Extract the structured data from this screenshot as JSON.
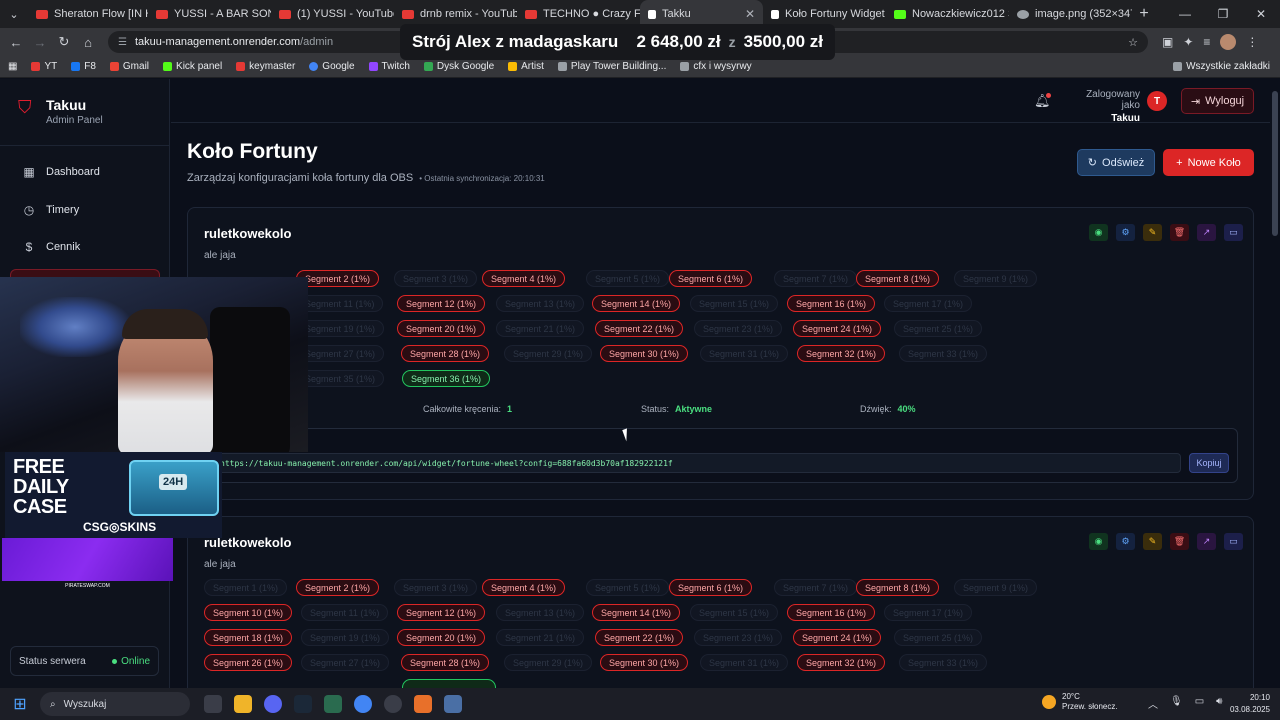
{
  "browser": {
    "tabs": [
      {
        "title": "Sheraton Flow [IN HA",
        "color": "#e53935"
      },
      {
        "title": "YUSSI - A BAR SONG",
        "color": "#e53935"
      },
      {
        "title": "(1) YUSSI - YouTube",
        "color": "#e53935"
      },
      {
        "title": "drnb remix - YouTube",
        "color": "#e53935"
      },
      {
        "title": "TECHNO ● Crazy Fro",
        "color": "#e53935"
      },
      {
        "title": "Takku",
        "color": "#ffffff"
      },
      {
        "title": "Koło Fortuny Widget",
        "color": "#ffffff"
      },
      {
        "title": "Nowaczkiewicz012 St",
        "color": "#53fc18"
      },
      {
        "title": "image.png (352×347)",
        "color": "#9aa0a6"
      }
    ],
    "url_host": "takuu-management.onrender.com",
    "url_path": "/admin",
    "bookmarks": [
      {
        "label": "YT",
        "color": "#e53935"
      },
      {
        "label": "F8",
        "color": "#1877f2"
      },
      {
        "label": "Gmail",
        "color": "#ea4335"
      },
      {
        "label": "Kick panel",
        "color": "#53fc18"
      },
      {
        "label": "keymaster",
        "color": "#e53935"
      },
      {
        "label": "Google",
        "color": "#4285f4"
      },
      {
        "label": "Twitch",
        "color": "#9146ff"
      },
      {
        "label": "Dysk Google",
        "color": "#34a853"
      },
      {
        "label": "Artist",
        "color": "#fbbc04"
      },
      {
        "label": "Play Tower Building...",
        "color": "#9aa0a6"
      },
      {
        "label": "cfx i wysyrwy",
        "color": "#9aa0a6"
      }
    ],
    "bookmarks_all": "Wszystkie zakładki"
  },
  "goal_overlay": {
    "title": "Strój Alex z madagaskaru",
    "current": "2 648,00 zł",
    "separator": "z",
    "target": "3500,00 zł"
  },
  "sidebar": {
    "brand_title": "Takuu",
    "brand_subtitle": "Admin Panel",
    "items": [
      {
        "label": "Dashboard",
        "icon": "grid-icon"
      },
      {
        "label": "Timery",
        "icon": "timer-icon"
      },
      {
        "label": "Cennik",
        "icon": "dollar-icon"
      }
    ],
    "server_status_label": "Status serwera",
    "server_status_value": "Online"
  },
  "topbar": {
    "logged_as_label": "Zalogowany jako",
    "user": "Takuu",
    "avatar_letter": "T",
    "logout_label": "Wyloguj"
  },
  "page": {
    "title": "Koło Fortuny",
    "subtitle": "Zarządzaj konfiguracjami koła fortuny dla OBS",
    "sync": "• Ostatnia synchronizacja: 20:10:31",
    "refresh_label": "Odśwież",
    "new_label": "Nowe Koło"
  },
  "cards": [
    {
      "name": "ruletkowekolo",
      "description": "ale jaja",
      "segments": [
        {
          "label": "Segment 2 (1%)",
          "state": "on"
        },
        {
          "label": "Segment 4 (1%)",
          "state": "on"
        },
        {
          "label": "Segment 6 (1%)",
          "state": "on"
        },
        {
          "label": "Segment 8 (1%)",
          "state": "on"
        },
        {
          "label": "Segment 12 (1%)",
          "state": "on"
        },
        {
          "label": "Segment 14 (1%)",
          "state": "on"
        },
        {
          "label": "Segment 16 (1%)",
          "state": "on"
        },
        {
          "label": "Segment 20 (1%)",
          "state": "on"
        },
        {
          "label": "Segment 22 (1%)",
          "state": "on"
        },
        {
          "label": "Segment 24 (1%)",
          "state": "on"
        },
        {
          "label": "Segment 28 (1%)",
          "state": "on"
        },
        {
          "label": "Segment 30 (1%)",
          "state": "on"
        },
        {
          "label": "Segment 32 (1%)",
          "state": "on"
        },
        {
          "label": "Segment 36 (1%)",
          "state": "win"
        }
      ],
      "total_spins_label": "Całkowite kręcenia:",
      "total_spins": "1",
      "status_label": "Status:",
      "status": "Aktywne",
      "sound_label": "Dźwięk:",
      "sound": "40%",
      "widget_url": "https://takuu-management.onrender.com/api/widget/fortune-wheel?config=688fa60d3b70af182922121f",
      "copy_label": "Kopiuj"
    },
    {
      "name": "ruletkowekolo",
      "description": "ale jaja",
      "segments": [
        {
          "label": "Segment 2 (1%)",
          "state": "on"
        },
        {
          "label": "Segment 4 (1%)",
          "state": "on"
        },
        {
          "label": "Segment 6 (1%)",
          "state": "on"
        },
        {
          "label": "Segment 8 (1%)",
          "state": "on"
        },
        {
          "label": "Segment 10 (1%)",
          "state": "on"
        },
        {
          "label": "Segment 12 (1%)",
          "state": "on"
        },
        {
          "label": "Segment 14 (1%)",
          "state": "on"
        },
        {
          "label": "Segment 16 (1%)",
          "state": "on"
        },
        {
          "label": "Segment 18 (1%)",
          "state": "on"
        },
        {
          "label": "Segment 20 (1%)",
          "state": "on"
        },
        {
          "label": "Segment 22 (1%)",
          "state": "on"
        },
        {
          "label": "Segment 24 (1%)",
          "state": "on"
        },
        {
          "label": "Segment 26 (1%)",
          "state": "on"
        },
        {
          "label": "Segment 28 (1%)",
          "state": "on"
        },
        {
          "label": "Segment 30 (1%)",
          "state": "on"
        },
        {
          "label": "Segment 32 (1%)",
          "state": "on"
        }
      ]
    }
  ],
  "stream_widgets": {
    "promo_line1": "FREE",
    "promo_line2": "DAILY",
    "promo_line3": "CASE",
    "promo_case_label": "24H",
    "promo_brand": "CSG◎SKINS",
    "purple_banner": "PIRATESWAP.COM"
  },
  "taskbar": {
    "search_placeholder": "Wyszukaj",
    "temperature": "20°C",
    "weather": "Przew. słonecz.",
    "time": "20:10",
    "date": "03.08.2025"
  },
  "colors": {
    "accent_red": "#dc2626",
    "success_green": "#4ade80",
    "background": "#0b0f1a"
  }
}
